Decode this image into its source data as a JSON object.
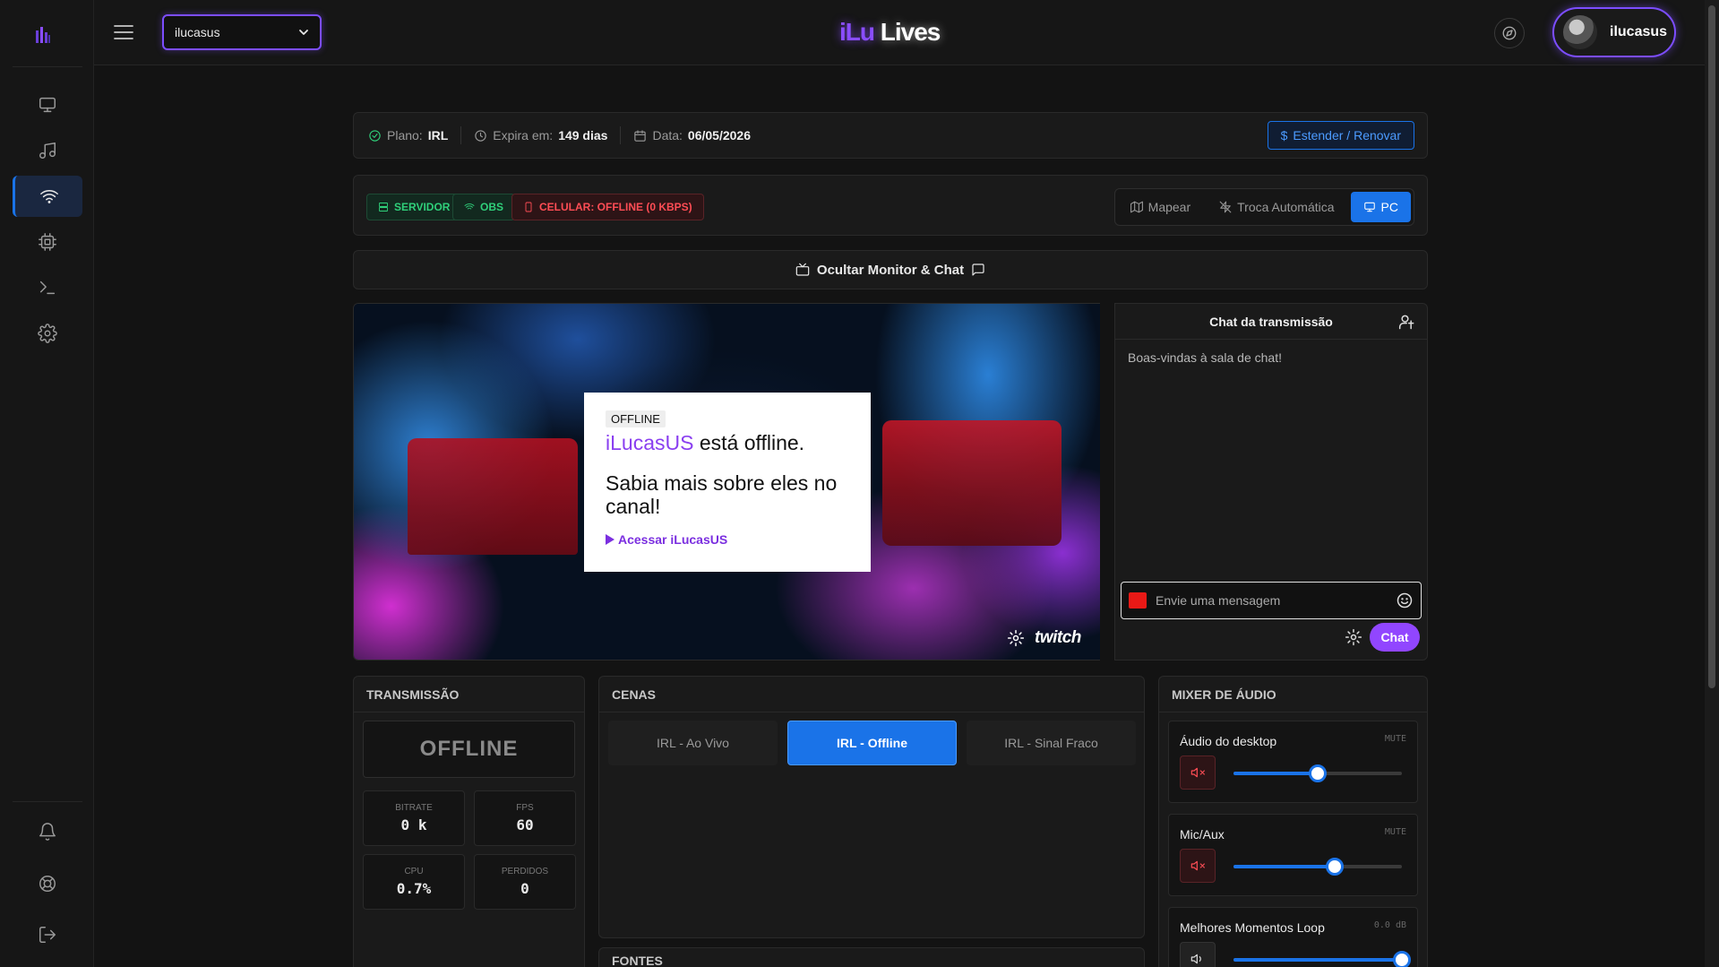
{
  "header": {
    "brand_part1": "iLu",
    "brand_part2": "Lives",
    "channel_select_value": "ilucasus",
    "user_name": "ilucasus"
  },
  "sidebar": {
    "items": [
      {
        "name": "monitor",
        "icon": "monitor-icon",
        "active": false
      },
      {
        "name": "music",
        "icon": "music-icon",
        "active": false
      },
      {
        "name": "wifi",
        "icon": "wifi-icon",
        "active": true
      },
      {
        "name": "chip",
        "icon": "cpu-icon",
        "active": false
      },
      {
        "name": "terminal",
        "icon": "terminal-icon",
        "active": false
      },
      {
        "name": "settings",
        "icon": "gear-icon",
        "active": false
      }
    ],
    "bottom_items": [
      {
        "name": "notifications",
        "icon": "bell-icon"
      },
      {
        "name": "support",
        "icon": "lifebuoy-icon"
      },
      {
        "name": "logout",
        "icon": "logout-icon"
      }
    ]
  },
  "plan": {
    "plan_label": "Plano:",
    "plan_value": "IRL",
    "expires_label": "Expira em:",
    "expires_value": "149 dias",
    "date_label": "Data:",
    "date_value": "06/05/2026",
    "renew_label": "Estender / Renovar"
  },
  "status": {
    "server_label": "SERVIDOR",
    "obs_label": "OBS",
    "phone_label": "CELULAR: OFFLINE (0 KBPS)",
    "modes": [
      {
        "label": "Mapear",
        "active": false
      },
      {
        "label": "Troca Automática",
        "active": false
      },
      {
        "label": "PC",
        "active": true
      }
    ]
  },
  "monitor": {
    "toggle_label": "Ocultar Monitor & Chat"
  },
  "player": {
    "offline_tag": "OFFLINE",
    "channel_name": "iLucasUS",
    "offline_text": "está offline.",
    "more_text": "Sabia mais sobre eles no canal!",
    "link_text": "Acessar iLucasUS",
    "platform": "twitch"
  },
  "chat": {
    "title": "Chat da transmissão",
    "welcome": "Boas-vindas à sala de chat!",
    "input_placeholder": "Envie uma mensagem",
    "send_label": "Chat"
  },
  "transmission": {
    "title": "TRANSMISSÃO",
    "status": "OFFLINE",
    "stats": [
      {
        "label": "BITRATE",
        "value": "0 k"
      },
      {
        "label": "FPS",
        "value": "60"
      },
      {
        "label": "CPU",
        "value": "0.7%"
      },
      {
        "label": "PERDIDOS",
        "value": "0"
      }
    ]
  },
  "scenes": {
    "title": "CENAS",
    "items": [
      {
        "label": "IRL - Ao Vivo",
        "active": false
      },
      {
        "label": "IRL - Offline",
        "active": true
      },
      {
        "label": "IRL - Sinal Fraco",
        "active": false
      }
    ]
  },
  "sources": {
    "title": "FONTES"
  },
  "mixer": {
    "title": "MIXER DE ÁUDIO",
    "channels": [
      {
        "name": "Áudio do desktop",
        "tag": "MUTE",
        "muted": true,
        "level": 0.5
      },
      {
        "name": "Mic/Aux",
        "tag": "MUTE",
        "muted": true,
        "level": 0.6
      },
      {
        "name": "Melhores Momentos Loop",
        "tag": "0.0 dB",
        "muted": false,
        "level": 1.0
      }
    ]
  },
  "colors": {
    "accent": "#1a73e8",
    "brand_purple": "#8a4dff",
    "ok_green": "#2fd07a",
    "error_red": "#ff4d55",
    "twitch_purple": "#9146ff"
  }
}
